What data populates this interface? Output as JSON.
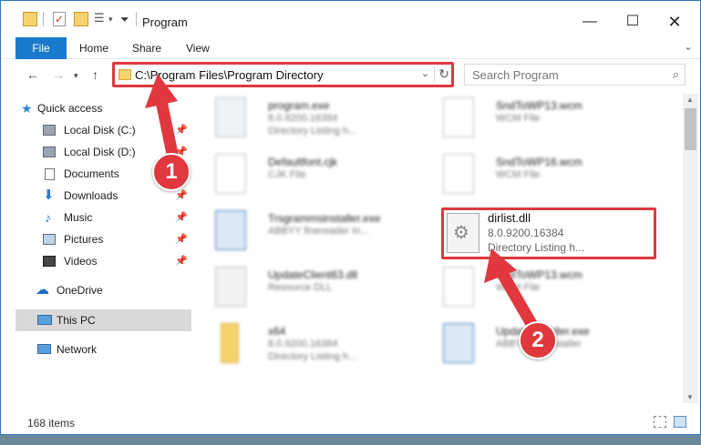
{
  "window": {
    "title": "Program"
  },
  "ribbon": {
    "tabs": [
      "File",
      "Home",
      "Share",
      "View"
    ]
  },
  "address": {
    "path": "C:\\Program Files\\Program Directory"
  },
  "search": {
    "placeholder": "Search Program"
  },
  "nav": {
    "items": [
      "Quick access",
      "Local Disk (C:)",
      "Local Disk (D:)",
      "Documents",
      "Downloads",
      "Music",
      "Pictures",
      "Videos",
      "OneDrive",
      "This PC",
      "Network"
    ],
    "selected": "This PC"
  },
  "files": [
    {
      "name": "program.exe",
      "line1": "8.0.9200.16384",
      "line2": "Directory Listing h..."
    },
    {
      "name": "SndToWP13.wcm",
      "line1": "WCM File",
      "line2": ""
    },
    {
      "name": "Defaultfont.cjk",
      "line1": "CJK File",
      "line2": ""
    },
    {
      "name": "SndToWP16.wcm",
      "line1": "WCM File",
      "line2": ""
    },
    {
      "name": "Trsgrammsinstaller.exe",
      "line1": "ABBYY finereader In...",
      "line2": ""
    },
    {
      "name": "dirlist.dll",
      "line1": "8.0.9200.16384",
      "line2": "Directory Listing h..."
    },
    {
      "name": "UpdateClient63.dll",
      "line1": "Resource DLL",
      "line2": ""
    },
    {
      "name": "SndToWP13.wcm",
      "line1": "WCM File",
      "line2": ""
    },
    {
      "name": "x64",
      "line1": "8.0.9200.16384",
      "line2": "Directory Listing h..."
    },
    {
      "name": "UpdateInstaller.exe",
      "line1": "ABBYY ws installer",
      "line2": ""
    }
  ],
  "status": {
    "items": "168 items"
  },
  "badges": [
    "1",
    "2"
  ],
  "colors": {
    "accent": "#1979ca",
    "highlight": "#e0383e"
  }
}
